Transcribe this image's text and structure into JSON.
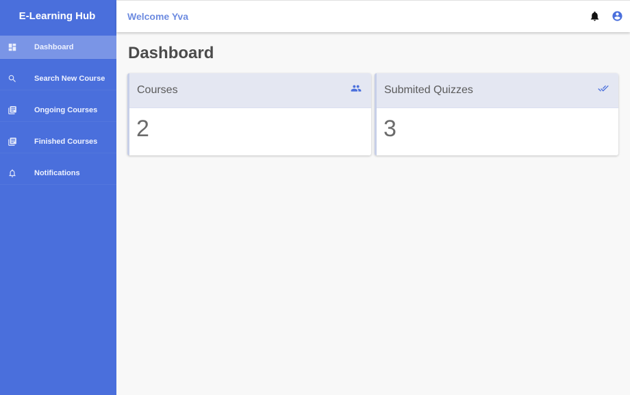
{
  "app": {
    "brand": "E-Learning Hub"
  },
  "topbar": {
    "welcome": "Welcome Yva",
    "icons": [
      "bell-icon",
      "account-circle-icon"
    ]
  },
  "sidebar": {
    "items": [
      {
        "label": "Dashboard",
        "icon": "dashboard-icon",
        "active": true
      },
      {
        "label": "Search New Course",
        "icon": "search-icon",
        "active": false
      },
      {
        "label": "Ongoing Courses",
        "icon": "library-books-icon",
        "active": false
      },
      {
        "label": "Finished Courses",
        "icon": "library-books-icon",
        "active": false
      },
      {
        "label": "Notifications",
        "icon": "bell-outline-icon",
        "active": false
      }
    ]
  },
  "main": {
    "title": "Dashboard",
    "cards": [
      {
        "title": "Courses",
        "value": "2",
        "icon": "people-icon"
      },
      {
        "title": "Submited Quizzes",
        "value": "3",
        "icon": "double-check-icon"
      }
    ]
  },
  "colors": {
    "accent": "#4a6fdc",
    "sidebar_active": "#7a95e6",
    "welcome_text": "#6d8be0",
    "card_header": "#e4e7f2",
    "page_bg": "#f8f8f8"
  }
}
